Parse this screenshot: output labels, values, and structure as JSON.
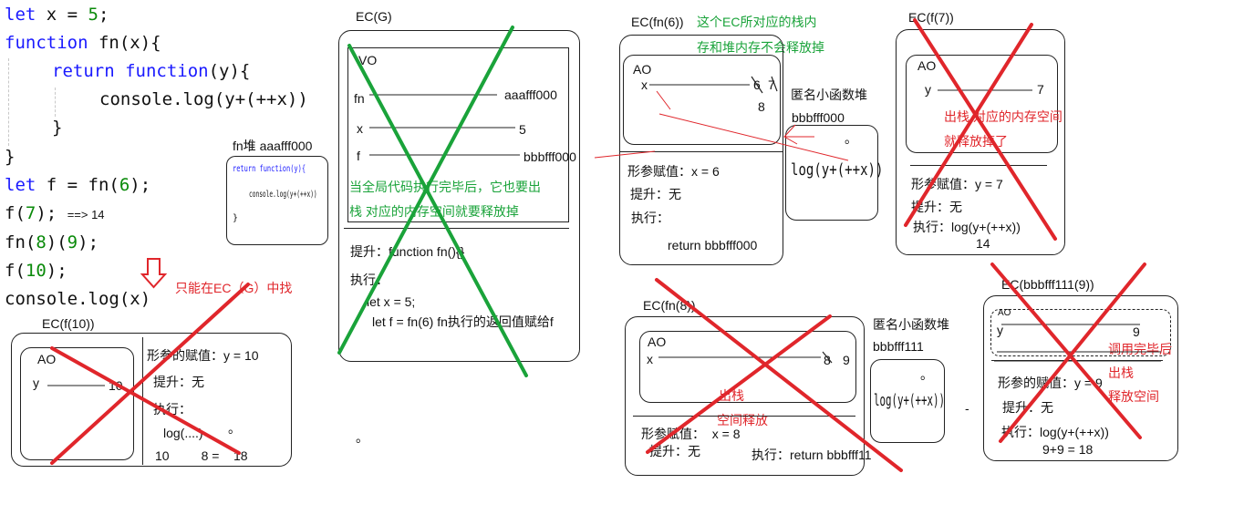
{
  "code": {
    "line1": {
      "kw": "let",
      "rest": " x = ",
      "num": "5",
      "end": ";"
    },
    "line2": {
      "kw": "function",
      "rest": " fn(x){"
    },
    "line3": {
      "kw1": "return",
      "kw2": "function",
      "rest": "(y){"
    },
    "line4": "console.log(y+(++x))",
    "line5": "}",
    "line6": "}",
    "line7": {
      "kw": "let",
      "rest": " f = fn(",
      "num": "6",
      "end": ");"
    },
    "line8": {
      "a": "f(",
      "num": "7",
      "b": ");",
      "note": "==> 14"
    },
    "line9": {
      "a": "fn(",
      "num1": "8",
      "b": ")(",
      "num2": "9",
      "c": ");"
    },
    "line10": {
      "a": "f(",
      "num": "10",
      "b": ");"
    },
    "line11": "console.log(x)",
    "only_ec_g": "只能在EC（G）中找"
  },
  "fn_heap": {
    "title": "fn堆 aaafff000",
    "code1": "return function(y){",
    "code2": "console.log(y+(++x))",
    "code3": "}"
  },
  "ec_g": {
    "title": "EC(G)",
    "vo": "VO",
    "fn_label": "fn",
    "fn_val": "aaafff000",
    "x_label": "x",
    "x_val": "5",
    "f_label": "f",
    "f_val": "bbbfff000",
    "note1": "当全局代码执行完毕后，它也要出",
    "note2": "栈  对应的内存空间就要释放掉",
    "hoist": "提升：function fn(){}",
    "exec": "执行：",
    "exec1": "let x = 5;",
    "exec2": "let f = fn(6)   fn执行的返回值赋给f",
    "dot": "。"
  },
  "ec_fn6": {
    "title": "EC(fn(6))",
    "note1": "这个EC所对应的栈内",
    "note2": "存和堆内存不会释放掉",
    "ao": "AO",
    "x_label": "x",
    "x_val1": "6",
    "x_val2": "7",
    "x_val3": "8",
    "param": "形参赋值：x = 6",
    "hoist": "提升：无",
    "exec": "执行：",
    "ret": "return bbbfff000"
  },
  "anon_heap1": {
    "title": "匿名小函数堆",
    "addr": "bbbfff000",
    "code": "log(y+(++x))",
    "dot": "。"
  },
  "ec_f7": {
    "title": "EC(f(7))",
    "ao": "AO",
    "y_label": "y",
    "y_val": "7",
    "note1": "出栈  对应的内存空间",
    "note2": "就释放掉了",
    "param": "形参赋值：y = 7",
    "hoist": "提升：无",
    "exec": "执行：log(y+(++x))",
    "result": "14"
  },
  "ec_f10": {
    "title": "EC(f(10))",
    "ao": "AO",
    "y_label": "y",
    "y_val": "10",
    "param": "形参的赋值：y = 10",
    "hoist": "提升：无",
    "exec": "执行：",
    "log": "log(....)",
    "dot": "。",
    "calc": "10         8 =    18"
  },
  "ec_fn8": {
    "title": "EC(fn(8))",
    "ao": "AO",
    "x_label": "x",
    "x_val1": "8",
    "x_val2": "9",
    "note1": "出栈",
    "note2": "空间释放",
    "param": "形参赋值：  x = 8",
    "hoist": "提升：无",
    "exec": "执行：return bbbfff11"
  },
  "anon_heap2": {
    "title": "匿名小函数堆",
    "addr": "bbbfff111",
    "code": "log(y+(++x))",
    "dot": "。",
    "dash": "-"
  },
  "ec_bbb": {
    "title": "EC(bbbfff111(9))",
    "ao": "AO",
    "y_label": "y",
    "y_val": "9",
    "note1": "调用完毕后",
    "note2": "出栈",
    "note3": "释放空间",
    "param": "形参的赋值：y = 9",
    "hoist": "提升：无",
    "exec": "执行：log(y+(++x))",
    "result": "9+9 = 18"
  },
  "stray_dot": "。",
  "colors": {
    "keyword": "#1a1aff",
    "number": "#0a8a0a",
    "red": "#e0262b",
    "green": "#1aa33a"
  }
}
